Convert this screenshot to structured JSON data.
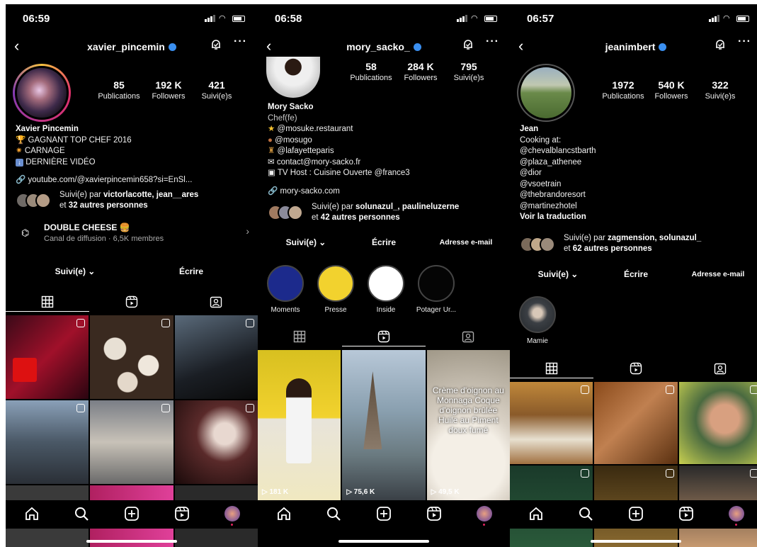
{
  "screens": [
    {
      "time": "06:59",
      "username": "xavier_pincemin",
      "stats": [
        {
          "value": "85",
          "label": "Publications"
        },
        {
          "value": "192 K",
          "label": "Followers"
        },
        {
          "value": "421",
          "label": "Suivi(e)s"
        }
      ],
      "name": "Xavier Pincemin",
      "bio_lines": [
        {
          "icon": "trophy-icon",
          "text": "GAGNANT TOP CHEF 2016"
        },
        {
          "icon": "sparkle-icon",
          "text": "CARNAGE"
        },
        {
          "icon": "down-arrow-icon",
          "text": "DERNIÈRE VIDÉO"
        }
      ],
      "link": "youtube.com/@xavierpincemin658?si=EnSl...",
      "followed_by_prefix": "Suivi(e) par ",
      "followed_by_names": "victorlacotte, jean__ares",
      "followed_by_suffix_pre": "et ",
      "followed_by_others": "32 autres personnes",
      "channel_title": "DOUBLE CHEESE 🍔",
      "channel_sub": "Canal de diffusion · 6,5K membres",
      "buttons": [
        "Suivi(e) ⌄",
        "Écrire"
      ],
      "active_tab": 0
    },
    {
      "time": "06:58",
      "username": "mory_sacko_",
      "stats": [
        {
          "value": "58",
          "label": "Publications"
        },
        {
          "value": "284 K",
          "label": "Followers"
        },
        {
          "value": "795",
          "label": "Suivi(e)s"
        }
      ],
      "name": "Mory Sacko",
      "category": "Chef(fe)",
      "bio_lines": [
        {
          "icon": "star-icon",
          "text": "@mosuke.restaurant"
        },
        {
          "icon": "food-icon",
          "text": "@mosugo"
        },
        {
          "icon": "trophy-icon",
          "text": "@lafayetteparis"
        },
        {
          "icon": "mail-icon",
          "text": "contact@mory-sacko.fr"
        },
        {
          "icon": "tv-icon",
          "text": "TV Host : Cuisine Ouverte @france3"
        }
      ],
      "link": "mory-sacko.com",
      "followed_by_prefix": "Suivi(e) par ",
      "followed_by_names": "solunazul_, paulineluzerne",
      "followed_by_suffix_pre": "et ",
      "followed_by_others": "42 autres personnes",
      "buttons": [
        "Suivi(e) ⌄",
        "Écrire",
        "Adresse e-mail"
      ],
      "highlights": [
        {
          "label": "Moments",
          "color": "#1c2a8c"
        },
        {
          "label": "Presse",
          "color": "#f2d22e"
        },
        {
          "label": "Inside",
          "color": "#ffffff"
        },
        {
          "label": "Potager Ur...",
          "color": "#050505"
        }
      ],
      "reels": [
        {
          "views": "▷ 181 K"
        },
        {
          "views": "▷ 75,6 K"
        },
        {
          "views": "▷ 49,5 K",
          "overlay": "Crème d'oignon au Monnaga Coque d'oignon brûlée Huile au Piment doux fumé"
        }
      ],
      "active_tab": 1
    },
    {
      "time": "06:57",
      "username": "jeanimbert",
      "stats": [
        {
          "value": "1972",
          "label": "Publications"
        },
        {
          "value": "540 K",
          "label": "Followers"
        },
        {
          "value": "322",
          "label": "Suivi(e)s"
        }
      ],
      "name": "Jean",
      "bio_lines": [
        {
          "icon": "",
          "text": "Cooking at:"
        },
        {
          "icon": "",
          "text": "@chevalblancstbarth"
        },
        {
          "icon": "",
          "text": "@plaza_athenee"
        },
        {
          "icon": "",
          "text": "@dior"
        },
        {
          "icon": "",
          "text": "@vsoetrain"
        },
        {
          "icon": "",
          "text": "@thebrandoresort"
        },
        {
          "icon": "",
          "text": "@martinezhotel"
        }
      ],
      "translate": "Voir la traduction",
      "followed_by_prefix": "Suivi(e) par ",
      "followed_by_names": "zagmension, solunazul_",
      "followed_by_suffix_pre": "et ",
      "followed_by_others": "62 autres personnes",
      "buttons": [
        "Suivi(e) ⌄",
        "Écrire",
        "Adresse e-mail"
      ],
      "highlights": [
        {
          "label": "Mamie",
          "color": "#3b3f44"
        }
      ],
      "active_tab": 0
    }
  ]
}
